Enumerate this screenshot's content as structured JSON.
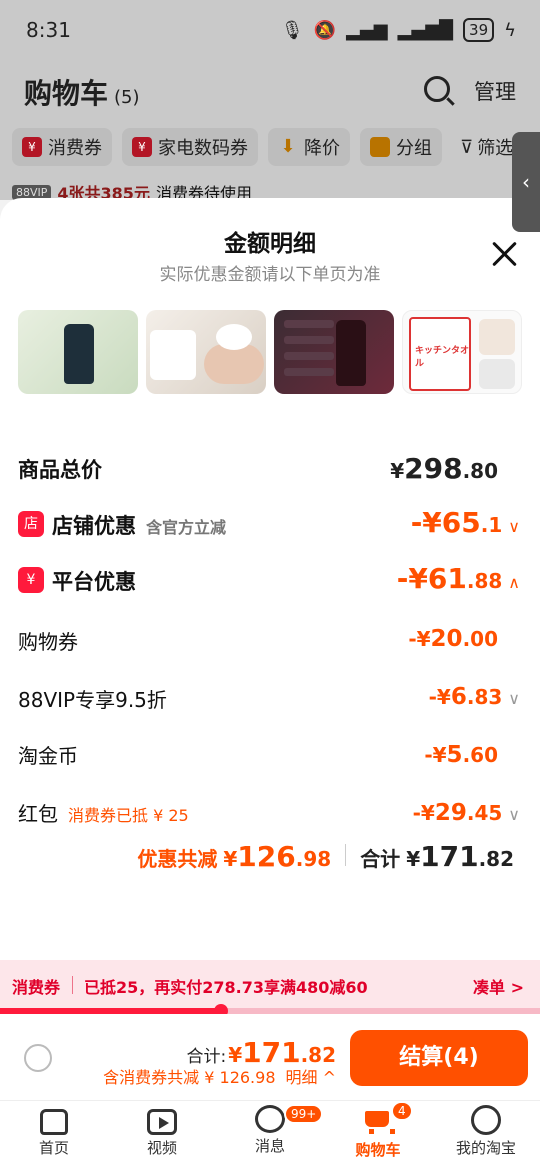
{
  "status_bar": {
    "time": "8:31",
    "battery": "39"
  },
  "cart_header": {
    "title": "购物车",
    "count": "(5)",
    "manage_label": "管理",
    "filters": [
      "消费券",
      "家电数码券",
      "降价",
      "分组"
    ],
    "filter_label": "筛选",
    "vip_tag": "88VIP",
    "vip_text": "4张共385元",
    "vip_suffix": "消费券待使用"
  },
  "sheet": {
    "title": "金额明细",
    "subtitle": "实际优惠金额请以下单页为准",
    "product_thumbnails": [
      "product-1",
      "product-2",
      "product-3",
      "product-4"
    ],
    "thumb_texts": {
      "pack_brand": "キッチンタオル"
    },
    "rows": {
      "total": {
        "label": "商品总价",
        "yen": "¥",
        "int": "298",
        "dec": ".80"
      },
      "shop": {
        "label": "店铺优惠",
        "note": "含官方立减",
        "prefix": "-¥",
        "int": "65",
        "dec": ".1"
      },
      "platform": {
        "label": "平台优惠",
        "prefix": "-¥",
        "int": "61",
        "dec": ".88"
      },
      "coupon": {
        "label": "购物券",
        "prefix": "-¥",
        "int": "20",
        "dec": ".00"
      },
      "vip": {
        "label": "88VIP专享9.5折",
        "prefix": "-¥",
        "int": "6",
        "dec": ".83"
      },
      "coin": {
        "label": "淘金币",
        "prefix": "-¥",
        "int": "5",
        "dec": ".60"
      },
      "redpacket": {
        "label": "红包",
        "note": "消费券已抵 ¥ 25",
        "prefix": "-¥",
        "int": "29",
        "dec": ".45"
      }
    },
    "summary": {
      "discount_label": "优惠共减",
      "discount_yen": "¥",
      "discount_int": "126",
      "discount_dec": ".98",
      "total_label": "合计",
      "total_yen": "¥",
      "total_int": "171",
      "total_dec": ".82"
    }
  },
  "coupon_banner": {
    "label": "消费券",
    "message": "已抵25，再实付278.73享满480减60",
    "link": "凑单 >",
    "progress": 0.41
  },
  "checkout": {
    "total_label": "合计:",
    "yen": "¥",
    "total_int": "171",
    "total_dec": ".82",
    "discount_text": "含消费券共减 ¥ 126.98",
    "detail_label": "明细 ^",
    "pay_label": "结算(4)"
  },
  "tabbar": {
    "tabs": [
      {
        "label": "首页"
      },
      {
        "label": "视频"
      },
      {
        "label": "消息",
        "badge": "99+"
      },
      {
        "label": "购物车",
        "badge": "4"
      },
      {
        "label": "我的淘宝"
      }
    ]
  },
  "colors": {
    "accent": "#ff5000",
    "red": "#ff1a3c",
    "coupon_bg": "#fde6ea"
  }
}
